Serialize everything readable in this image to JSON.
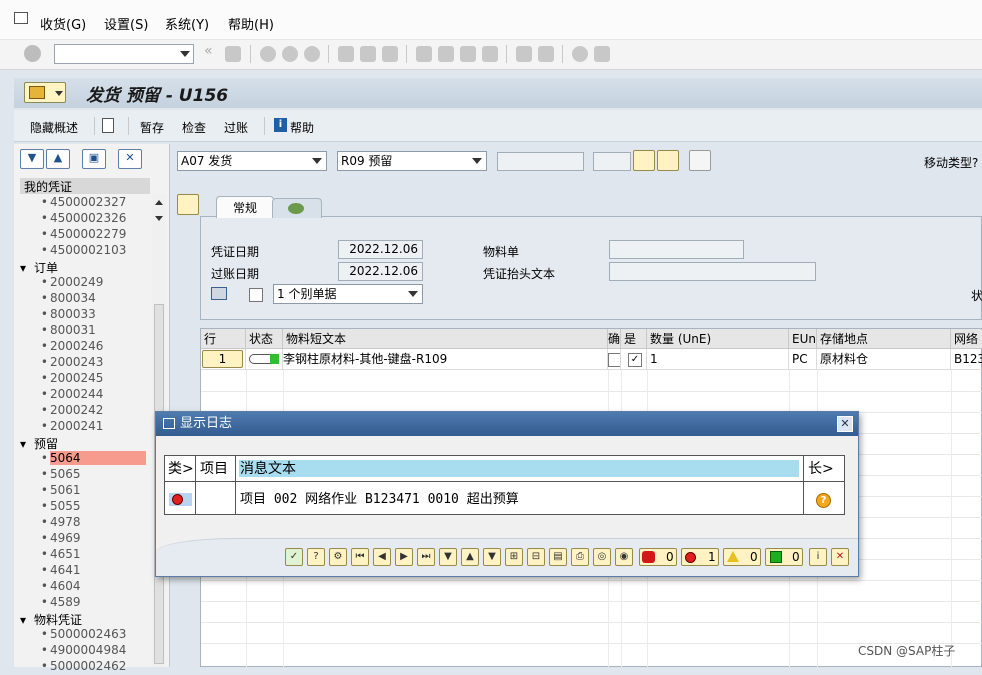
{
  "menu": {
    "items": [
      "收货(G)",
      "设置(S)",
      "系统(Y)",
      "帮助(H)"
    ]
  },
  "title": "发货 预留 - U156",
  "app_toolbar": {
    "hide_overview": "隐藏概述",
    "hold": "暂存",
    "check": "检查",
    "post": "过账",
    "help": "帮助"
  },
  "left_pane": {
    "header": "我的凭证",
    "tree": [
      {
        "label": "4500002327",
        "type": "item"
      },
      {
        "label": "4500002326",
        "type": "item"
      },
      {
        "label": "4500002279",
        "type": "item"
      },
      {
        "label": "4500002103",
        "type": "item"
      },
      {
        "label": "订单",
        "type": "group"
      },
      {
        "label": "2000249",
        "type": "item"
      },
      {
        "label": "800034",
        "type": "item"
      },
      {
        "label": "800033",
        "type": "item"
      },
      {
        "label": "800031",
        "type": "item"
      },
      {
        "label": "2000246",
        "type": "item"
      },
      {
        "label": "2000243",
        "type": "item"
      },
      {
        "label": "2000245",
        "type": "item"
      },
      {
        "label": "2000244",
        "type": "item"
      },
      {
        "label": "2000242",
        "type": "item"
      },
      {
        "label": "2000241",
        "type": "item"
      },
      {
        "label": "预留",
        "type": "group"
      },
      {
        "label": "5064",
        "type": "item",
        "selected": true
      },
      {
        "label": "5065",
        "type": "item"
      },
      {
        "label": "5061",
        "type": "item"
      },
      {
        "label": "5055",
        "type": "item"
      },
      {
        "label": "4978",
        "type": "item"
      },
      {
        "label": "4969",
        "type": "item"
      },
      {
        "label": "4651",
        "type": "item"
      },
      {
        "label": "4641",
        "type": "item"
      },
      {
        "label": "4604",
        "type": "item"
      },
      {
        "label": "4589",
        "type": "item"
      },
      {
        "label": "物料凭证",
        "type": "group"
      },
      {
        "label": "5000002463",
        "type": "item"
      },
      {
        "label": "4900004984",
        "type": "item"
      },
      {
        "label": "5000002462",
        "type": "item"
      }
    ]
  },
  "header_fields": {
    "transaction": "A07 发货",
    "reference": "R09 预留",
    "movement_type_label": "移动类型?"
  },
  "tabs": {
    "general": "常规"
  },
  "general": {
    "doc_date_label": "凭证日期",
    "doc_date": "2022.12.06",
    "post_date_label": "过账日期",
    "post_date": "2022.12.06",
    "material_slip_label": "物料单",
    "header_text_label": "凭证抬头文本",
    "print_option": "1 个别单据",
    "cut_label": "状"
  },
  "grid": {
    "headers": [
      "行",
      "状态",
      "物料短文本",
      "确",
      "是",
      "数量 (UnE)",
      "EUn",
      "存储地点",
      "网络"
    ],
    "rows": [
      {
        "line": "1",
        "text": "李钢柱原材料-其他-键盘-R109",
        "qty": "1",
        "uom": "PC",
        "sloc": "原材料仓",
        "network": "B123"
      }
    ]
  },
  "dialog": {
    "title": "显示日志",
    "headers": {
      "type": "类>",
      "item": "项目",
      "message": "消息文本",
      "long": "长>"
    },
    "message": "项目 002 网络作业 B123471 0010 超出预算",
    "counts": {
      "stop": "0",
      "error": "1",
      "warning": "0",
      "success": "0"
    }
  },
  "watermark": "CSDN @SAP柱子"
}
